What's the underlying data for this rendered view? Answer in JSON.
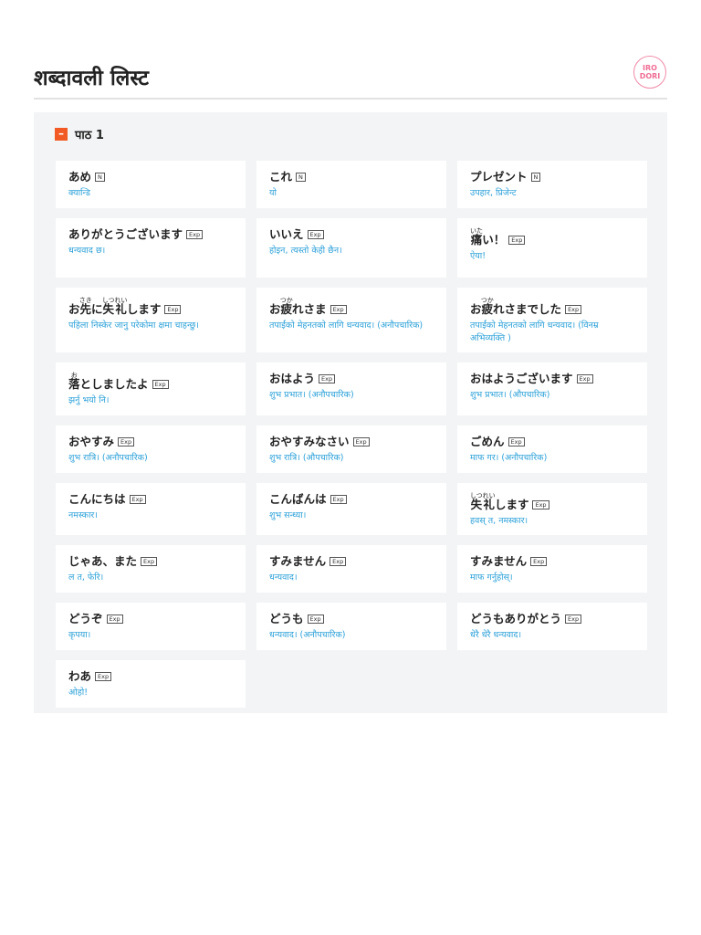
{
  "header": {
    "title": "शब्दावली लिस्ट",
    "logo_text": "IRODORI"
  },
  "lesson": {
    "toggle_icon": "minus-icon",
    "label": "पाठ 1"
  },
  "colors": {
    "accent": "#f15a24",
    "meaning": "#2aa0d8",
    "panel": "#f2f4f5"
  },
  "cards": [
    {
      "segments": [
        {
          "t": "あめ"
        }
      ],
      "tag": "N",
      "meaning": "क्यान्डि"
    },
    {
      "segments": [
        {
          "t": "これ"
        }
      ],
      "tag": "N",
      "meaning": "यो"
    },
    {
      "segments": [
        {
          "t": "プレゼント"
        }
      ],
      "tag": "N",
      "meaning": "उपहार, प्रिजेन्ट"
    },
    {
      "segments": [
        {
          "t": "ありがとうございます"
        }
      ],
      "tag": "Exp",
      "meaning": "धन्यवाद छ।"
    },
    {
      "segments": [
        {
          "t": "いいえ"
        }
      ],
      "tag": "Exp",
      "meaning": "होइन, त्यस्तो केही छैन।"
    },
    {
      "segments": [
        {
          "t": "痛",
          "r": "いた"
        },
        {
          "t": "い！"
        }
      ],
      "tag": "Exp",
      "meaning": "ऐया!"
    },
    {
      "segments": [
        {
          "t": "お"
        },
        {
          "t": "先",
          "r": "さき"
        },
        {
          "t": "に"
        },
        {
          "t": "失礼",
          "r": "しつれい"
        },
        {
          "t": "します"
        }
      ],
      "tag": "Exp",
      "meaning": "पहिला निस्केर जानु परेकोमा क्षमा चाहन्छु।"
    },
    {
      "segments": [
        {
          "t": "お"
        },
        {
          "t": "疲",
          "r": "つか"
        },
        {
          "t": "れさま"
        }
      ],
      "tag": "Exp",
      "meaning": "तपाईंको मेहनतको लागि धन्यवाद। (अनौपचारिक)"
    },
    {
      "segments": [
        {
          "t": "お"
        },
        {
          "t": "疲",
          "r": "つか"
        },
        {
          "t": "れさまでした"
        }
      ],
      "tag": "Exp",
      "meaning": "तपाईंको मेहनतको लागि धन्यवाद। (विनम्र अभिव्यक्ति )"
    },
    {
      "segments": [
        {
          "t": "落",
          "r": "お"
        },
        {
          "t": "としましたよ"
        }
      ],
      "tag": "Exp",
      "meaning": "झर्नु भयो नि।"
    },
    {
      "segments": [
        {
          "t": "おはよう"
        }
      ],
      "tag": "Exp",
      "meaning": "शुभ प्रभात। (अनौपचारिक)"
    },
    {
      "segments": [
        {
          "t": "おはようございます"
        }
      ],
      "tag": "Exp",
      "meaning": "शुभ प्रभात। (औपचारिक)"
    },
    {
      "segments": [
        {
          "t": "おやすみ"
        }
      ],
      "tag": "Exp",
      "meaning": "शुभ रात्रि। (अनौपचारिक)"
    },
    {
      "segments": [
        {
          "t": "おやすみなさい"
        }
      ],
      "tag": "Exp",
      "meaning": "शुभ रात्रि। (औपचारिक)"
    },
    {
      "segments": [
        {
          "t": "ごめん"
        }
      ],
      "tag": "Exp",
      "meaning": "माफ गर। (अनौपचारिक)"
    },
    {
      "segments": [
        {
          "t": "こんにちは"
        }
      ],
      "tag": "Exp",
      "meaning": "नमस्कार।"
    },
    {
      "segments": [
        {
          "t": "こんばんは"
        }
      ],
      "tag": "Exp",
      "meaning": "शुभ सन्ध्या।"
    },
    {
      "segments": [
        {
          "t": "失礼",
          "r": "しつれい"
        },
        {
          "t": "します"
        }
      ],
      "tag": "Exp",
      "meaning": "हवस् त, नमस्कार।"
    },
    {
      "segments": [
        {
          "t": "じゃあ、また"
        }
      ],
      "tag": "Exp",
      "meaning": "ल त, फेरि।"
    },
    {
      "segments": [
        {
          "t": "すみません"
        }
      ],
      "tag": "Exp",
      "meaning": "धन्यवाद।"
    },
    {
      "segments": [
        {
          "t": "すみません"
        }
      ],
      "tag": "Exp",
      "meaning": "माफ गर्नुहोस्।"
    },
    {
      "segments": [
        {
          "t": "どうぞ"
        }
      ],
      "tag": "Exp",
      "meaning": "कृपया।"
    },
    {
      "segments": [
        {
          "t": "どうも"
        }
      ],
      "tag": "Exp",
      "meaning": "धन्यवाद। (अनौपचारिक)"
    },
    {
      "segments": [
        {
          "t": "どうもありがとう"
        }
      ],
      "tag": "Exp",
      "meaning": "धेरै धेरै धन्यवाद।"
    },
    {
      "segments": [
        {
          "t": "わあ"
        }
      ],
      "tag": "Exp",
      "meaning": "ओहो!"
    }
  ]
}
